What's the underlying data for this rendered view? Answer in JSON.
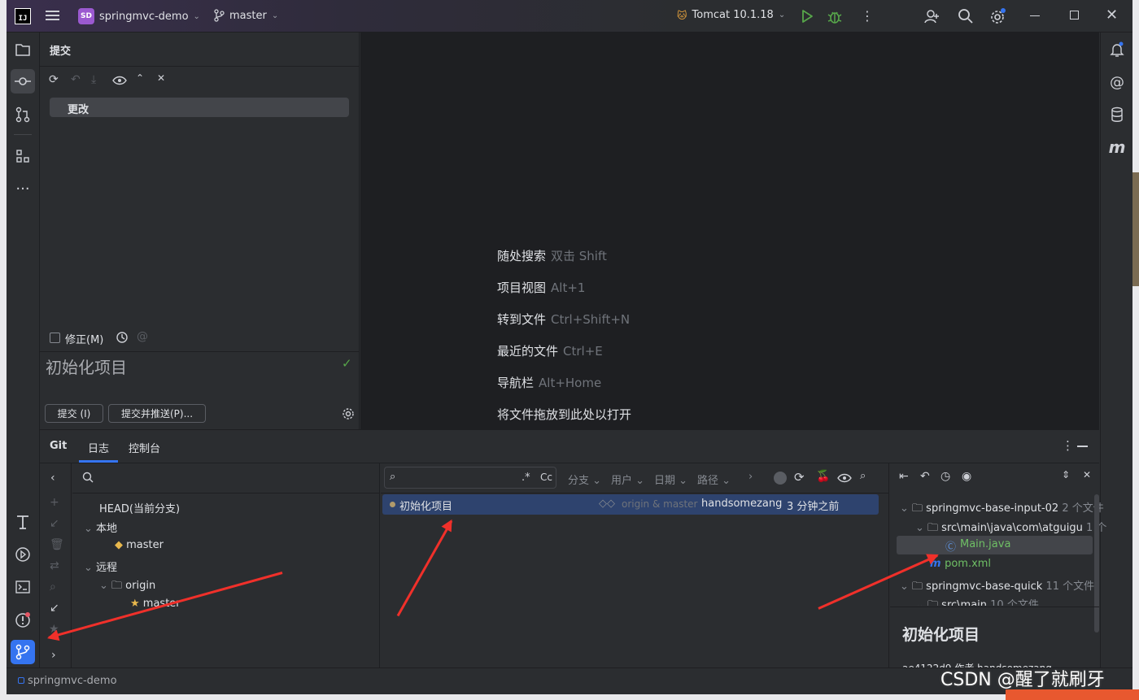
{
  "titlebar": {
    "project_badge": "SD",
    "project_name": "springmvc-demo",
    "branch": "master",
    "run_config": "Tomcat 10.1.18"
  },
  "commit_panel": {
    "title": "提交",
    "changes_group": "更改",
    "amend_label": "修正(M)",
    "commit_message": "初始化项目",
    "commit_button": "提交 (I)",
    "commit_push_button": "提交并推送(P)..."
  },
  "editor_hints": [
    {
      "action": "随处搜索",
      "shortcut": "双击 Shift"
    },
    {
      "action": "项目视图",
      "shortcut": "Alt+1"
    },
    {
      "action": "转到文件",
      "shortcut": "Ctrl+Shift+N"
    },
    {
      "action": "最近的文件",
      "shortcut": "Ctrl+E"
    },
    {
      "action": "导航栏",
      "shortcut": "Alt+Home"
    },
    {
      "action": "将文件拖放到此处以打开",
      "shortcut": ""
    }
  ],
  "git_panel": {
    "title": "Git",
    "tabs": [
      "日志",
      "控制台"
    ],
    "branches": {
      "head": "HEAD(当前分支)",
      "local_group": "本地",
      "local_master": "master",
      "remote_group": "远程",
      "origin": "origin",
      "origin_master": "master"
    },
    "log_filters": {
      "regex": ".*",
      "case": "Cc",
      "branch": "分支",
      "user": "用户",
      "date": "日期",
      "path": "路径"
    },
    "commit_row": {
      "message": "初始化项目",
      "refs": "origin & master",
      "author": "handsomezang",
      "time": "3 分钟之前"
    },
    "changes_tree": [
      {
        "name": "springmvc-base-input-02",
        "meta": "2 个文件"
      },
      {
        "name": "src\\main\\java\\com\\atguigu",
        "meta": "1 个"
      },
      {
        "name": "Main.java",
        "meta": ""
      },
      {
        "name": "pom.xml",
        "meta": ""
      },
      {
        "name": "springmvc-base-quick",
        "meta": "11 个文件"
      },
      {
        "name": "src\\main",
        "meta": "10 个文件"
      }
    ],
    "details": {
      "title": "初始化项目",
      "hash_line": "ae4122d9 作者 handsomezang"
    }
  },
  "status_bar": {
    "project": "springmvc-demo"
  },
  "watermark": "CSDN @醒了就刷牙",
  "colors": {
    "accent": "#3574f0",
    "selected_row": "#2e436e",
    "annotation_arrow": "#f0302a"
  }
}
